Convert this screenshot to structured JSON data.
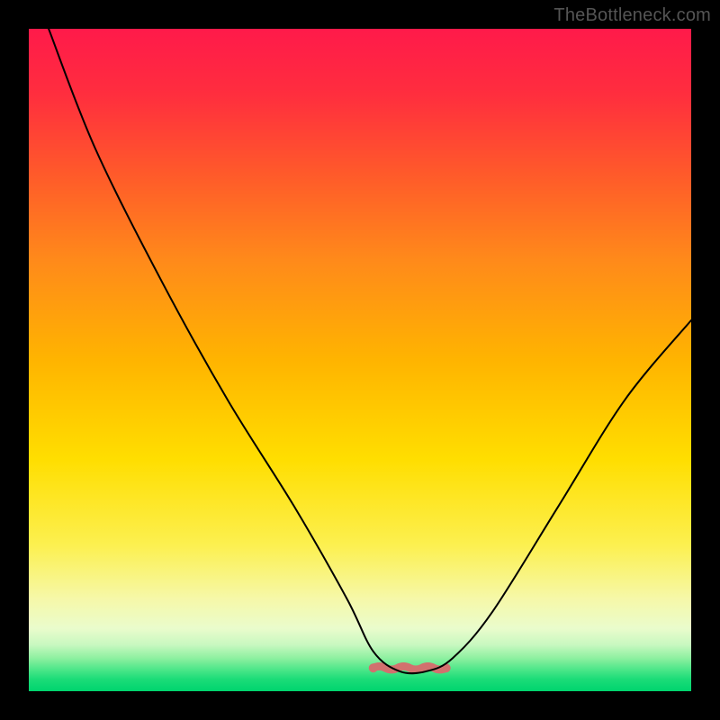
{
  "watermark": {
    "text": "TheBottleneck.com"
  },
  "gradient": {
    "stops": [
      {
        "offset": 0.0,
        "color": "#ff1a4a"
      },
      {
        "offset": 0.1,
        "color": "#ff2e3e"
      },
      {
        "offset": 0.22,
        "color": "#ff5a2a"
      },
      {
        "offset": 0.35,
        "color": "#ff8a1a"
      },
      {
        "offset": 0.5,
        "color": "#ffb400"
      },
      {
        "offset": 0.65,
        "color": "#ffde00"
      },
      {
        "offset": 0.78,
        "color": "#fcf050"
      },
      {
        "offset": 0.86,
        "color": "#f6f8a8"
      },
      {
        "offset": 0.905,
        "color": "#eafccc"
      },
      {
        "offset": 0.93,
        "color": "#c8f8c0"
      },
      {
        "offset": 0.95,
        "color": "#8ef0a0"
      },
      {
        "offset": 0.968,
        "color": "#4ae688"
      },
      {
        "offset": 0.982,
        "color": "#1bdc78"
      },
      {
        "offset": 1.0,
        "color": "#00d46e"
      }
    ]
  },
  "chart_data": {
    "type": "line",
    "title": "",
    "xlabel": "",
    "ylabel": "",
    "xlim": [
      0,
      100
    ],
    "ylim": [
      0,
      100
    ],
    "series": [
      {
        "name": "bottleneck-curve",
        "x": [
          3,
          10,
          20,
          30,
          40,
          48,
          52,
          56,
          60,
          64,
          70,
          80,
          90,
          100
        ],
        "y": [
          100,
          82,
          62,
          44,
          28,
          14,
          6,
          3,
          3,
          5,
          12,
          28,
          44,
          56
        ]
      }
    ],
    "flat_band": {
      "x_start": 52,
      "x_end": 63,
      "y": 3.5,
      "color": "#d2706e",
      "thickness": 2.2
    },
    "curve_stroke": {
      "color": "#000000",
      "width": 2
    }
  }
}
